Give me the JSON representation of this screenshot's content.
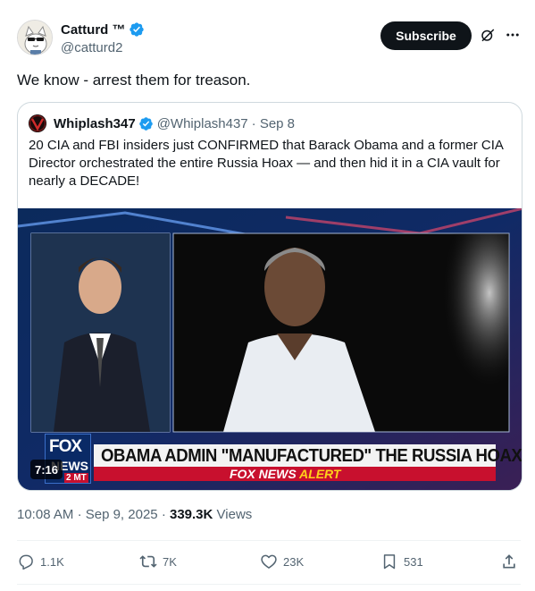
{
  "author": {
    "name": "Catturd ™",
    "handle": "@catturd2",
    "avatar_icon": "cat-avatar-icon"
  },
  "header": {
    "subscribe_label": "Subscribe",
    "grok_icon": "grok-icon",
    "more_icon": "more-icon"
  },
  "tweet": {
    "text": "We know - arrest them for treason."
  },
  "quote": {
    "name": "Whiplash347",
    "handle": "@Whiplash437",
    "date": "· Sep 8",
    "text": "20 CIA and FBI insiders just CONFIRMED that Barack Obama and a former CIA Director orchestrated the entire Russia Hoax — and then hid it in a CIA vault for nearly a DECADE!",
    "video": {
      "duration": "7:16",
      "headline": "OBAMA ADMIN \"MANUFACTURED\" THE RUSSIA HOAX",
      "alert_prefix": "FOX NEWS",
      "alert_word": "ALERT",
      "logo_top": "FOX",
      "logo_bottom": "NEWS",
      "clock": "2 MT"
    }
  },
  "meta": {
    "time": "10:08 AM",
    "date": "Sep 9, 2025",
    "views_count": "339.3K",
    "views_label": "Views"
  },
  "actions": {
    "replies": "1.1K",
    "reposts": "7K",
    "likes": "23K",
    "bookmarks": "531"
  },
  "colors": {
    "text_primary": "#0f1419",
    "text_secondary": "#536471",
    "verified_blue": "#1d9bf0",
    "border": "#cfd9de",
    "fox_red": "#c8102e"
  }
}
